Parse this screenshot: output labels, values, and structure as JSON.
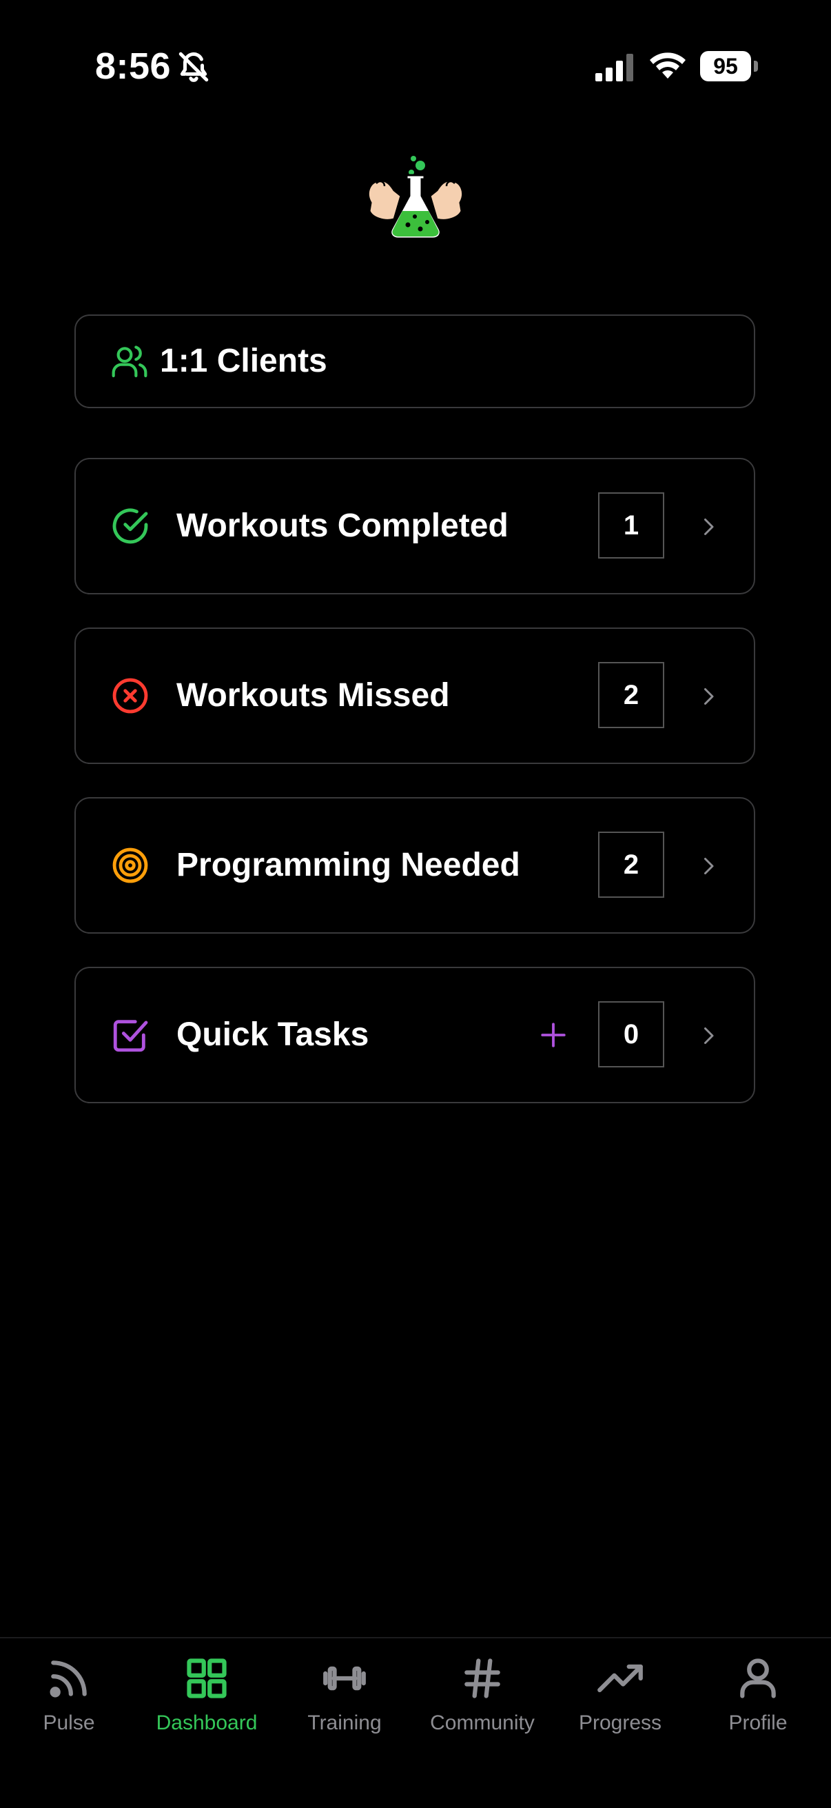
{
  "status_bar": {
    "time": "8:56",
    "battery": "95",
    "icons": [
      "bell-slash-icon",
      "cellular-signal-icon",
      "wifi-icon",
      "battery-icon"
    ]
  },
  "logo": {
    "icon": "muscle-flask-logo-icon"
  },
  "colors": {
    "green": "#34c759",
    "red": "#ff3b30",
    "orange": "#ff9f0a",
    "purple": "#af52de",
    "gray": "#8e8e93",
    "border": "#3a3a3c"
  },
  "clients": {
    "label": "1:1 Clients",
    "icon": "users-icon"
  },
  "rows": [
    {
      "label": "Workouts Completed",
      "count": "1",
      "icon": "check-circle-icon"
    },
    {
      "label": "Workouts Missed",
      "count": "2",
      "icon": "x-circle-icon"
    },
    {
      "label": "Programming Needed",
      "count": "2",
      "icon": "target-icon"
    },
    {
      "label": "Quick Tasks",
      "count": "0",
      "icon": "checkbox-icon",
      "action_icon": "plus-icon"
    }
  ],
  "tabs": [
    {
      "label": "Pulse",
      "icon": "rss-icon",
      "active": false
    },
    {
      "label": "Dashboard",
      "icon": "grid-icon",
      "active": true
    },
    {
      "label": "Training",
      "icon": "dumbbell-icon",
      "active": false
    },
    {
      "label": "Community",
      "icon": "hash-icon",
      "active": false
    },
    {
      "label": "Progress",
      "icon": "trending-up-icon",
      "active": false
    },
    {
      "label": "Profile",
      "icon": "user-icon",
      "active": false
    }
  ]
}
